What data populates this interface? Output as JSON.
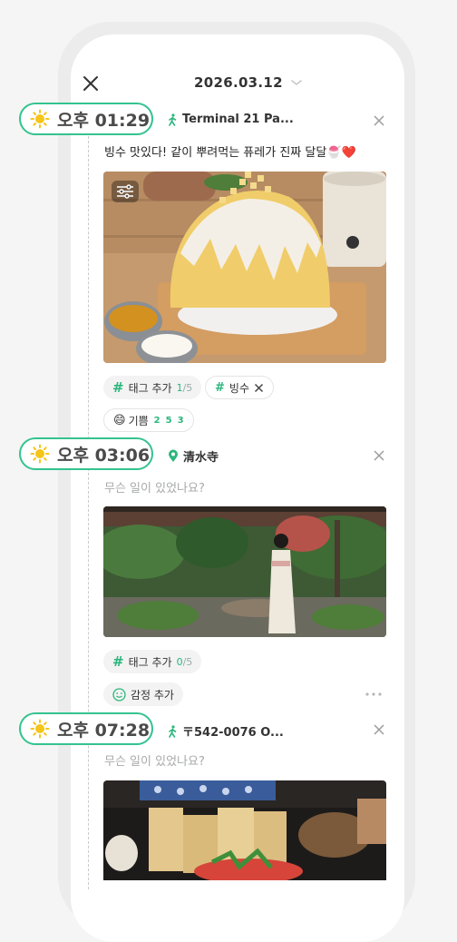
{
  "header": {
    "date": "2026.03.12"
  },
  "entries": [
    {
      "time": "오후 01:29",
      "location": "Terminal 21 Pa...",
      "location_icon": "walking-person-icon",
      "text": "빙수 맛있다! 같이 뿌려먹는 퓨레가 진짜 달달🍧❤️",
      "tag_add_label": "태그 추가",
      "tag_count": "1",
      "tag_max": "/5",
      "tags": [
        "빙수"
      ],
      "emotion": {
        "icon": "😄",
        "label": "기쁨",
        "counts": [
          "2",
          "5",
          "3"
        ]
      }
    },
    {
      "time": "오후 03:06",
      "location": "清水寺",
      "location_icon": "map-pin-icon",
      "placeholder": "무슨 일이 있었나요?",
      "tag_add_label": "태그 추가",
      "tag_count": "0",
      "tag_max": "/5",
      "emotion_add_label": "감정 추가"
    },
    {
      "time": "오후 07:28",
      "location": "〒542-0076 O...",
      "location_icon": "walking-person-icon",
      "placeholder": "무슨 일이 있었나요?"
    }
  ],
  "colors": {
    "accent": "#34c38f",
    "sun": "#f5c518"
  }
}
